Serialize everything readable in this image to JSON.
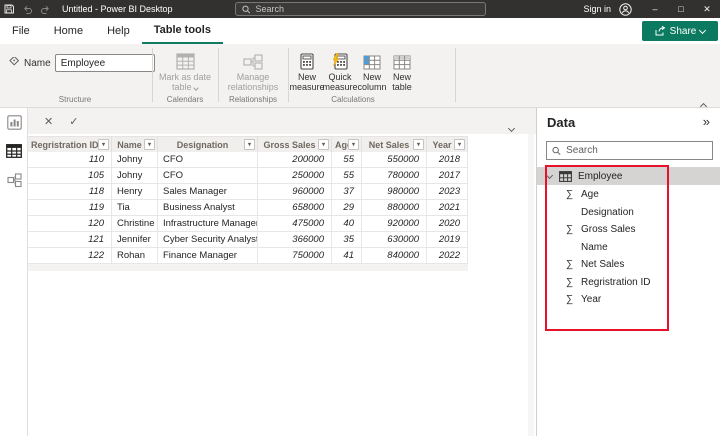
{
  "colors": {
    "titlebar_bg": "#323130",
    "accent_teal": "#0f7b5f",
    "share_button_bg": "#0b7a60",
    "highlight_red": "#e8112a",
    "selected_row_bg": "#d6d4d2",
    "disabled_text": "#a19f9d",
    "header_text": "#6f6860"
  },
  "icons": {
    "sigma": "∑",
    "caret_small": "▾",
    "double_chevron": "»",
    "minimize": "–",
    "maximize": "□",
    "close": "✕",
    "cancel": "✕",
    "check": "✓"
  },
  "titlebar": {
    "title": "Untitled - Power BI Desktop",
    "search_placeholder": "Search",
    "sign_in_label": "Sign in"
  },
  "menubar": {
    "tabs": [
      {
        "label": "File",
        "active": false
      },
      {
        "label": "Home",
        "active": false
      },
      {
        "label": "Help",
        "active": false
      },
      {
        "label": "Table tools",
        "active": true
      }
    ],
    "share_label": "Share"
  },
  "ribbon": {
    "name_label": "Name",
    "name_value": "Employee",
    "structure_group": "Structure",
    "mark_as_date_table": "Mark as date table",
    "calendars_group": "Calendars",
    "manage_relationships": "Manage relationships",
    "relationships_group": "Relationships",
    "new_measure": "New measure",
    "quick_measure": "Quick measure",
    "new_column": "New column",
    "new_table": "New table",
    "calculations_group": "Calculations"
  },
  "grid": {
    "columns": [
      "Regristration ID",
      "Name",
      "Designation",
      "Gross Sales",
      "Age",
      "Net Sales",
      "Year"
    ],
    "rows": [
      [
        "110",
        "Johny",
        "CFO",
        "200000",
        "55",
        "550000",
        "2018"
      ],
      [
        "105",
        "Johny",
        "CFO",
        "250000",
        "55",
        "780000",
        "2017"
      ],
      [
        "118",
        "Henry",
        "Sales Manager",
        "960000",
        "37",
        "980000",
        "2023"
      ],
      [
        "119",
        "Tia",
        "Business Analyst",
        "658000",
        "29",
        "880000",
        "2021"
      ],
      [
        "120",
        "Christine",
        "Infrastructure Manager",
        "475000",
        "40",
        "920000",
        "2020"
      ],
      [
        "121",
        "Jennifer",
        "Cyber Security Analyst",
        "366000",
        "35",
        "630000",
        "2019"
      ],
      [
        "122",
        "Rohan",
        "Finance Manager",
        "750000",
        "41",
        "840000",
        "2022"
      ]
    ]
  },
  "data_pane": {
    "title": "Data",
    "search_placeholder": "Search",
    "table": {
      "name": "Employee",
      "expanded": true,
      "selected": true
    },
    "fields": [
      {
        "name": "Age",
        "aggregate": true
      },
      {
        "name": "Designation",
        "aggregate": false
      },
      {
        "name": "Gross Sales",
        "aggregate": true
      },
      {
        "name": "Name",
        "aggregate": false
      },
      {
        "name": "Net Sales",
        "aggregate": true
      },
      {
        "name": "Regristration ID",
        "aggregate": true
      },
      {
        "name": "Year",
        "aggregate": true
      }
    ]
  }
}
